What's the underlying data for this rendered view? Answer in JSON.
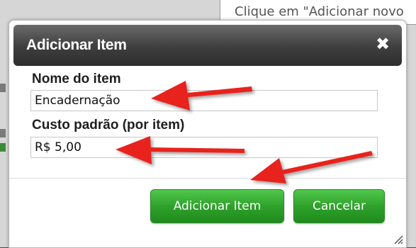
{
  "background": {
    "hint_text": "Clique em \"Adicionar novo"
  },
  "dialog": {
    "title": "Adicionar Item",
    "close_glyph": "✖",
    "fields": [
      {
        "label": "Nome do item",
        "value": "Encadernação",
        "placeholder": ""
      },
      {
        "label": "Custo padrão (por item)",
        "value": "R$ 5,00",
        "placeholder": ""
      }
    ],
    "buttons": {
      "add_label": "Adicionar Item",
      "cancel_label": "Cancelar"
    }
  },
  "colors": {
    "title_bar": "#3e3e3e",
    "button_green": "#2fa22b",
    "arrow_red": "#e8231b"
  },
  "icons": {
    "close": "close-icon",
    "resize": "resize-grip-icon"
  }
}
